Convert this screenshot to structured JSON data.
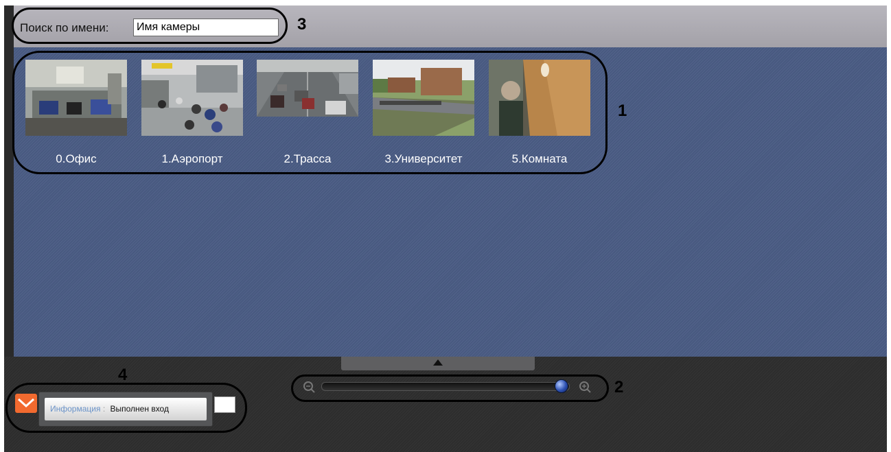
{
  "search": {
    "label": "Поиск по имени:",
    "value": "Имя камеры"
  },
  "cameras": [
    {
      "label": "0.Офис",
      "scene": "office"
    },
    {
      "label": "1.Аэропорт",
      "scene": "airport"
    },
    {
      "label": "2.Трасса",
      "scene": "highway"
    },
    {
      "label": "3.Университет",
      "scene": "university"
    },
    {
      "label": "5.Комната",
      "scene": "room"
    }
  ],
  "zoom": {
    "level": 0.97
  },
  "status": {
    "category": "Информация",
    "separator": ":",
    "message": "Выполнен вход"
  },
  "annotations": [
    "1",
    "2",
    "3",
    "4"
  ],
  "colors": {
    "main_bg": "#4b5d85",
    "topbar": "#b0aeb5",
    "mail_icon": "#f26a2f"
  }
}
